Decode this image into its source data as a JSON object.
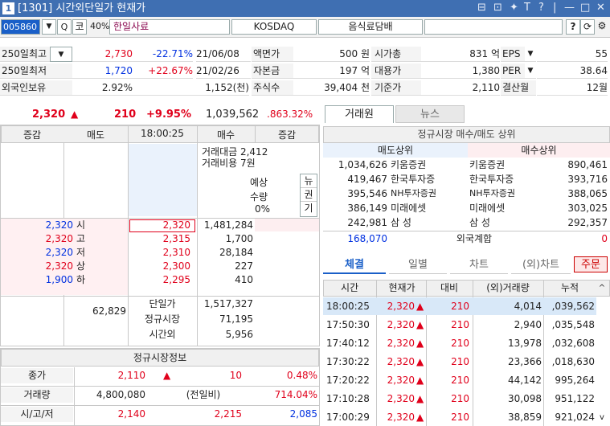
{
  "window": {
    "num": "1",
    "title": "[1301] 시간외단일가 현재가",
    "controls": [
      "⊟",
      "⊡",
      "✦",
      "T",
      "?",
      "|",
      "—",
      "□",
      "✕"
    ]
  },
  "codebar": {
    "code": "005860",
    "dropdown": "▼",
    "search": "Q",
    "ko": "코",
    "pct": "40%",
    "name": "한일사료",
    "market": "KOSDAQ",
    "sector": "음식료담배",
    "help": "?",
    "refresh": "⟳",
    "settings": "⚙"
  },
  "info": {
    "rows": [
      {
        "l1": "250일최고",
        "l1dd": "▼",
        "v1": "2,730",
        "v2": "-22.71%",
        "v3": "21/06/08",
        "l2": "액면가",
        "v4": "500 원",
        "l3": "시가총",
        "v5": "831 억",
        "l4": "EPS",
        "l4dd": "▼",
        "v6": "55"
      },
      {
        "l1": "250일최저",
        "v1": "1,720",
        "v2": "+22.67%",
        "v3": "21/02/26",
        "l2": "자본금",
        "v4": "197 억",
        "l3": "대용가",
        "v5": "1,380",
        "l4": "PER",
        "l4dd": "▼",
        "v6": "38.64"
      },
      {
        "l1": "외국인보유",
        "v1": "2.92%",
        "v2": "",
        "v3": "1,152(천)",
        "l2": "주식수",
        "v4": "39,404 천",
        "l3": "기준가",
        "v5": "2,110",
        "l4": "결산월",
        "v6": "12월"
      }
    ]
  },
  "price": {
    "price": "2,320",
    "arrow": "▲",
    "change": "210",
    "rate": "+9.95%",
    "volume": "1,039,562",
    "ratio": ".863.32%"
  },
  "orderbook": {
    "headers": [
      "증감",
      "매도",
      "18:00:25",
      "매수",
      "증감"
    ],
    "trade_amount": "거래대금 2,412",
    "trade_cost": "거래비용 7원",
    "expect_label": [
      "예상",
      "수량",
      "0%"
    ],
    "news_label": [
      "뉴",
      "권",
      "기"
    ],
    "asks": [
      {
        "price": "2,320",
        "tag": "시",
        "p": "2,320",
        "vol": "1,481,284"
      },
      {
        "price": "2,320",
        "tag": "고",
        "p": "2,315",
        "vol": "1,700"
      },
      {
        "price": "2,320",
        "tag": "저",
        "p": "2,310",
        "vol": "28,184"
      },
      {
        "price": "2,320",
        "tag": "상",
        "p": "2,300",
        "vol": "227"
      },
      {
        "price": "1,900",
        "tag": "하",
        "p": "2,295",
        "vol": "410"
      }
    ],
    "sum_left": "62,829",
    "sum_rows": [
      {
        "label": "단일가",
        "val": "1,517,327"
      },
      {
        "label": "정규시장",
        "val": "71,195"
      },
      {
        "label": "시간외",
        "val": "5,956"
      }
    ]
  },
  "regular": {
    "title": "정규시장정보",
    "rows": [
      {
        "label": "종가",
        "a": "2,110",
        "arrow": "▲",
        "b": "10",
        "c": "0.48%"
      },
      {
        "label": "거래량",
        "a": "4,800,080",
        "arrow": "",
        "b": "(전일비)",
        "c": "714.04%"
      },
      {
        "label": "시/고/저",
        "a": "2,140",
        "arrow": "",
        "b": "2,215",
        "c": "2,085"
      }
    ]
  },
  "broker": {
    "tabs": [
      "거래원",
      "뉴스"
    ],
    "title": "정규시장 매수/매도 상위",
    "sell_hdr": "매도상위",
    "buy_hdr": "매수상위",
    "rows": [
      {
        "sv": "1,034,626",
        "sn": "키움증권",
        "bn": "키움증권",
        "bv": "890,461"
      },
      {
        "sv": "419,467",
        "sn": "한국투자증",
        "bn": "한국투자증",
        "bv": "393,716"
      },
      {
        "sv": "395,546",
        "sn": "NH투자증권",
        "bn": "NH투자증권",
        "bv": "388,065"
      },
      {
        "sv": "386,149",
        "sn": "미래에셋",
        "bn": "미래에셋",
        "bv": "303,025"
      },
      {
        "sv": "242,981",
        "sn": "삼 성",
        "bn": "삼 성",
        "bv": "292,357"
      }
    ],
    "foreign_sell": "168,070",
    "foreign_label": "외국계합",
    "foreign_buy": "0"
  },
  "trades": {
    "tabs": [
      "체결",
      "일별",
      "차트",
      "(외)차트",
      "주문"
    ],
    "headers": [
      "시간",
      "현재가",
      "대비",
      "(외)거래량",
      "누적"
    ],
    "rows": [
      {
        "t": "18:00:25",
        "p": "2,320",
        "d": "210",
        "v": "4,014",
        "cum": ",039,562"
      },
      {
        "t": "17:50:30",
        "p": "2,320",
        "d": "210",
        "v": "2,940",
        "cum": ",035,548"
      },
      {
        "t": "17:40:12",
        "p": "2,320",
        "d": "210",
        "v": "13,978",
        "cum": ",032,608"
      },
      {
        "t": "17:30:22",
        "p": "2,320",
        "d": "210",
        "v": "23,366",
        "cum": ",018,630"
      },
      {
        "t": "17:20:22",
        "p": "2,320",
        "d": "210",
        "v": "44,142",
        "cum": "995,264"
      },
      {
        "t": "17:10:28",
        "p": "2,320",
        "d": "210",
        "v": "30,098",
        "cum": "951,122"
      },
      {
        "t": "17:00:29",
        "p": "2,320",
        "d": "210",
        "v": "38,859",
        "cum": "921,024"
      }
    ]
  },
  "colors": {
    "up": "#e0001b",
    "down": "#0030e0",
    "title": "#3f6fb2"
  }
}
